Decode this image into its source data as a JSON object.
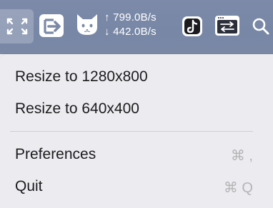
{
  "menubar": {
    "icons": [
      "resize-icon",
      "enter-icon",
      "cat-icon",
      "tiktok-icon",
      "screen-transfer-icon",
      "search-icon"
    ],
    "upload_speed": "↑ 799.0B/s",
    "download_speed": "↓ 442.0B/s"
  },
  "menu": {
    "items": [
      {
        "label": "Resize to 1280x800",
        "shortcut": ""
      },
      {
        "label": "Resize to 640x400",
        "shortcut": ""
      },
      {
        "label": "Preferences",
        "shortcut": "⌘ ,"
      },
      {
        "label": "Quit",
        "shortcut": "⌘ Q"
      }
    ]
  },
  "colors": {
    "menubar": "#7b89a7",
    "menu_bg": "#ecebef",
    "shortcut_text": "#b5b5b8"
  }
}
